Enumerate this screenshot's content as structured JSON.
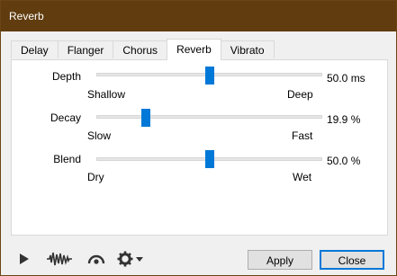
{
  "window": {
    "title": "Reverb"
  },
  "tabs": [
    {
      "label": "Delay"
    },
    {
      "label": "Flanger"
    },
    {
      "label": "Chorus"
    },
    {
      "label": "Reverb",
      "active": true
    },
    {
      "label": "Vibrato"
    }
  ],
  "sliders": {
    "depth": {
      "label": "Depth",
      "value_text": "50.0 ms",
      "min_label": "Shallow",
      "max_label": "Deep",
      "level": 0.5
    },
    "decay": {
      "label": "Decay",
      "value_text": "19.9 %",
      "min_label": "Slow",
      "max_label": "Fast",
      "level": 0.22
    },
    "blend": {
      "label": "Blend",
      "value_text": "50.0 %",
      "min_label": "Dry",
      "max_label": "Wet",
      "level": 0.5
    }
  },
  "toolbar": {
    "play_icon": "play-icon",
    "waveform_icon": "waveform-icon",
    "loop_icon": "loop-icon",
    "settings_icon": "gear-icon"
  },
  "buttons": {
    "apply": "Apply",
    "close": "Close"
  },
  "colors": {
    "accent": "#0078d7",
    "titlebar": "#603c0f"
  }
}
